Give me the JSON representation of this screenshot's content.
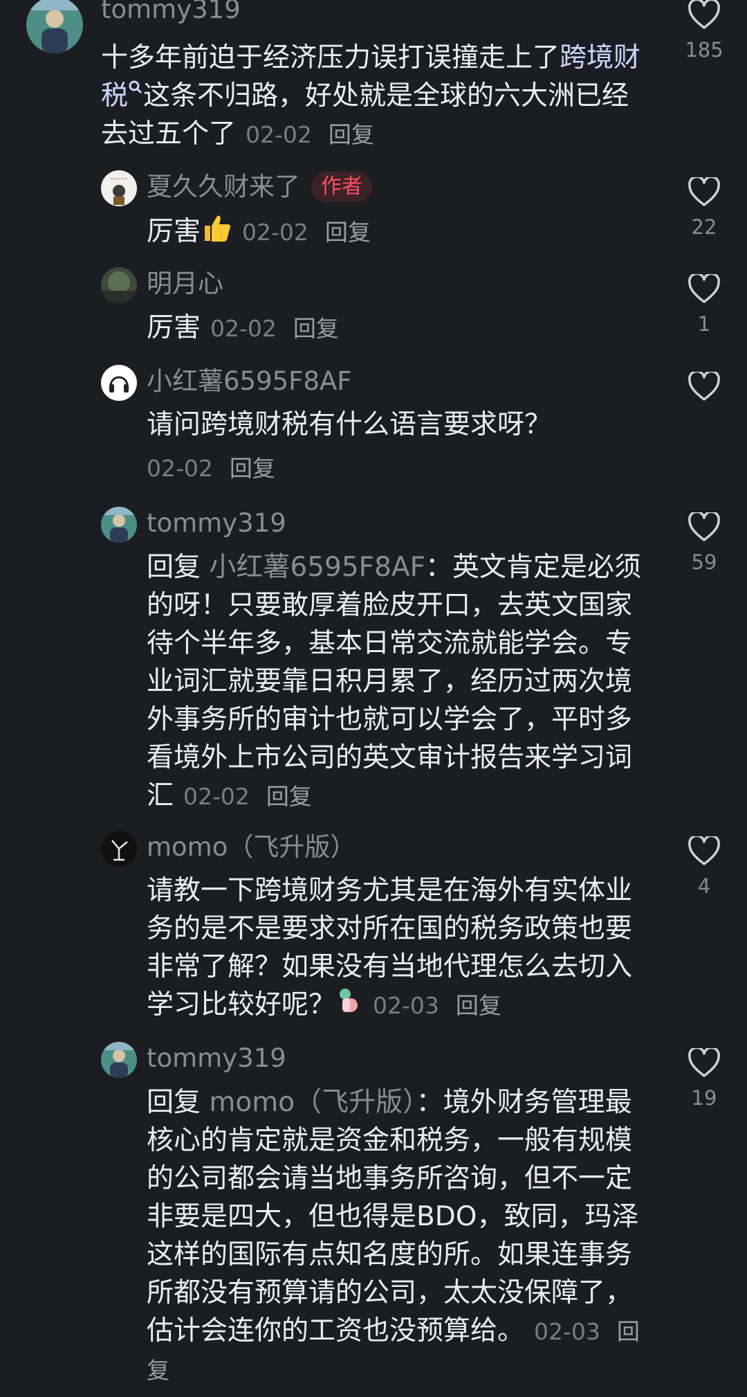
{
  "comments": [
    {
      "author": "tommy319",
      "text_pre": "十多年前迫于经济压力误打误撞走上了",
      "link": "跨境财税",
      "link_icon": "search-icon",
      "text_post": "这条不归路，好处就是全球的六大洲已经去过五个了",
      "date": "02-02",
      "reply": "回复",
      "likes": "185"
    },
    {
      "author": "夏久久财来了",
      "badge": "作者",
      "text": "厉害",
      "emoji": "thumbs-up-icon",
      "date": "02-02",
      "reply": "回复",
      "likes": "22"
    },
    {
      "author": "明月心",
      "text": "厉害",
      "date": "02-02",
      "reply": "回复",
      "likes": "1"
    },
    {
      "author": "小红薯6595F8AF",
      "text": "请问跨境财税有什么语言要求呀？",
      "date": "02-02",
      "reply": "回复",
      "likes": ""
    },
    {
      "author": "tommy319",
      "reply_prefix": "回复",
      "mention": "小红薯6595F8AF",
      "text": "：英文肯定是必须的呀！只要敢厚着脸皮开口，去英文国家待个半年多，基本日常交流就能学会。专业词汇就要靠日积月累了，经历过两次境外事务所的审计也就可以学会了，平时多看境外上市公司的英文审计报告来学习词汇",
      "date": "02-02",
      "reply": "回复",
      "likes": "59"
    },
    {
      "author": "momo（飞升版）",
      "text": "请教一下跨境财务尤其是在海外有实体业务的是不是要求对所在国的税务政策也要非常了解？如果没有当地代理怎么去切入学习比较好呢？",
      "emoji": "pill-icon",
      "date": "02-03",
      "reply": "回复",
      "likes": "4"
    },
    {
      "author": "tommy319",
      "reply_prefix": "回复",
      "mention": "momo（飞升版）",
      "text": "：境外财务管理最核心的肯定就是资金和税务，一般有规模的公司都会请当地事务所咨询，但不一定非要是四大，但也得是BDO，致同，玛泽这样的国际有点知名度的所。如果连事务所都没有预算请的公司，太太没保障了，估计会连你的工资也没预算给。",
      "date": "02-03",
      "reply": "回复",
      "likes": "19"
    }
  ],
  "colors": {
    "background": "#1c1d22",
    "author": "#8b8c93",
    "badge": "#ff4f5e",
    "link": "#c9d8ff"
  }
}
